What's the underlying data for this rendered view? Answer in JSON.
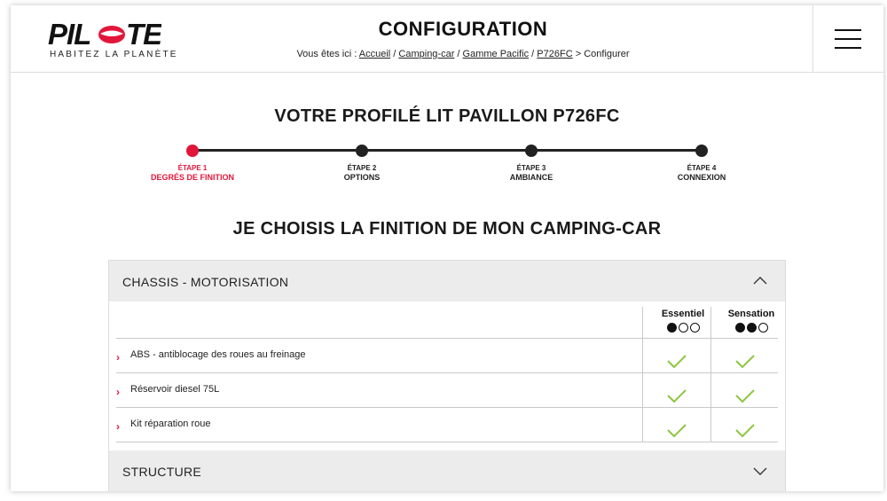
{
  "header": {
    "logo_text": "PILOTE",
    "logo_tagline": "HABITEZ LA PLANÈTE",
    "title": "CONFIGURATION",
    "breadcrumb": {
      "prefix": "Vous êtes ici :",
      "items": [
        "Accueil",
        "Camping-car",
        "Gamme Pacific",
        "P726FC"
      ],
      "current": "Configurer"
    }
  },
  "model_title": "VOTRE PROFILÉ LIT PAVILLON P726FC",
  "steps": [
    {
      "num": "ÉTAPE 1",
      "name": "DEGRÉS DE FINITION",
      "active": true
    },
    {
      "num": "ÉTAPE 2",
      "name": "OPTIONS",
      "active": false
    },
    {
      "num": "ÉTAPE 3",
      "name": "AMBIANCE",
      "active": false
    },
    {
      "num": "ÉTAPE 4",
      "name": "CONNEXION",
      "active": false
    }
  ],
  "section_title": "JE CHOISIS LA FINITION DE MON CAMPING-CAR",
  "accordion": [
    {
      "label": "CHASSIS - MOTORISATION",
      "expanded": true,
      "columns": [
        {
          "name": "Essentiel",
          "level": 1,
          "max": 3
        },
        {
          "name": "Sensation",
          "level": 2,
          "max": 3
        }
      ],
      "rows": [
        {
          "label": "ABS - antiblocage des roues au freinage",
          "values": [
            true,
            true
          ]
        },
        {
          "label": "Réservoir diesel 75L",
          "values": [
            true,
            true
          ]
        },
        {
          "label": "Kit réparation roue",
          "values": [
            true,
            true
          ]
        }
      ]
    },
    {
      "label": "STRUCTURE",
      "expanded": false
    }
  ],
  "colors": {
    "accent": "#e2163a",
    "check": "#8dc63f",
    "header_bg": "#ececec"
  }
}
